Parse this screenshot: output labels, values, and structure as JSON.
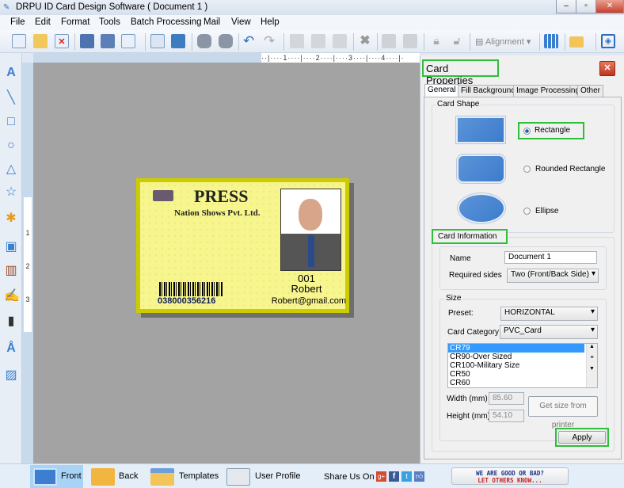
{
  "window": {
    "title": "DRPU ID Card Design Software ( Document 1 )"
  },
  "menu": [
    "File",
    "Edit",
    "Format",
    "Tools",
    "Batch Processing",
    "Mail",
    "View",
    "Help"
  ],
  "toolbar": {
    "alignment_label": "Alignment"
  },
  "ruler": {
    "h_marks": "··|····1····|····2····|····3····|····4····|·",
    "v_marks": [
      "1",
      "2",
      "3"
    ]
  },
  "card": {
    "title": "PRESS",
    "company": "Nation Shows Pvt. Ltd.",
    "id": "001",
    "name": "Robert",
    "email": "Robert@gmail.com",
    "barcode": "038000356216",
    "border_color": "#cccc00",
    "fill_color": "#f7f58e"
  },
  "panel": {
    "title": "Card Properties",
    "tabs": [
      "General",
      "Fill Background",
      "Image Processing",
      "Other"
    ],
    "card_shape": {
      "label": "Card Shape",
      "options": [
        "Rectangle",
        "Rounded Rectangle",
        "Ellipse"
      ],
      "selected": "Rectangle"
    },
    "card_info": {
      "label": "Card Information",
      "name_label": "Name",
      "name_value": "Document 1",
      "sides_label": "Required sides",
      "sides_value": "Two (Front/Back Side)"
    },
    "size": {
      "label": "Size",
      "preset_label": "Preset:",
      "preset_value": "HORIZONTAL",
      "category_label": "Card Category",
      "category_value": "PVC_Card",
      "list": [
        "CR79",
        "CR90-Over Sized",
        "CR100-Military Size",
        "CR50",
        "CR60"
      ],
      "selected": "CR79",
      "width_label": "Width  (mm)",
      "width_value": "85.60",
      "height_label": "Height  (mm)",
      "height_value": "54.10",
      "get_size_label": "Get size from printer"
    },
    "apply_label": "Apply"
  },
  "bottom": {
    "front": "Front",
    "back": "Back",
    "templates": "Templates",
    "user_profile": "User Profile",
    "share_label": "Share Us On :",
    "feedback_line1": "WE ARE GOOD OR BAD?",
    "feedback_line2": "LET OTHERS KNOW..."
  }
}
